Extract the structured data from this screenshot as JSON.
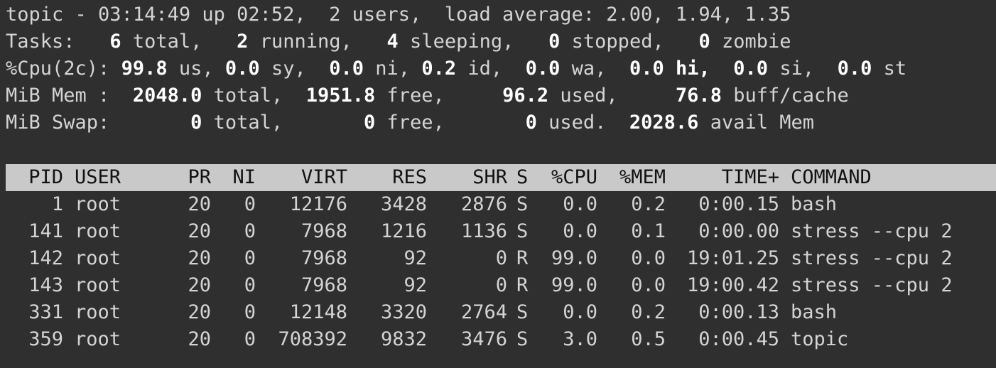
{
  "summary": {
    "uptime": {
      "label": "topic - ",
      "time": "03:14:49",
      "rest": " up 02:52,  2 users,  load average: 2.00, 1.94, 1.35"
    },
    "tasks": {
      "label": "Tasks:",
      "total": "6",
      "total_l": " total,",
      "running": "2",
      "running_l": " running,",
      "sleeping": "4",
      "sleeping_l": " sleeping,",
      "stopped": "0",
      "stopped_l": " stopped,",
      "zombie": "0",
      "zombie_l": " zombie"
    },
    "cpu": {
      "label": "%Cpu(2c):",
      "us": "99.8",
      "us_l": " us,",
      "sy": "0.0",
      "sy_l": " sy,",
      "ni": "0.0",
      "ni_l": " ni,",
      "id": "0.2",
      "id_l": " id,",
      "wa": "0.0",
      "wa_l": " wa,",
      "hi": "0.0",
      "hi_l": " hi,",
      "si": "0.0",
      "si_l": " si,",
      "st": "0.0",
      "st_l": " st"
    },
    "mem": {
      "label": "MiB Mem :",
      "total": "2048.0",
      "total_l": " total,",
      "free": "1951.8",
      "free_l": " free,",
      "used": "96.2",
      "used_l": " used,",
      "buff": "76.8",
      "buff_l": " buff/cache"
    },
    "swap": {
      "label": "MiB Swap:",
      "total": "0",
      "total_l": " total,",
      "free": "0",
      "free_l": " free,",
      "used": "0",
      "used_l": " used.",
      "avail": "2028.6",
      "avail_l": " avail Mem"
    }
  },
  "table": {
    "headers": {
      "pid": "PID",
      "user": "USER",
      "pr": "PR",
      "ni": "NI",
      "virt": "VIRT",
      "res": "RES",
      "shr": "SHR",
      "s": "S",
      "cpu": "%CPU",
      "mem": "%MEM",
      "time": "TIME+",
      "command": "COMMAND"
    },
    "rows": [
      {
        "pid": "1",
        "user": "root",
        "pr": "20",
        "ni": "0",
        "virt": "12176",
        "res": "3428",
        "shr": "2876",
        "s": "S",
        "cpu": "0.0",
        "mem": "0.2",
        "time": "0:00.15",
        "command": "bash"
      },
      {
        "pid": "141",
        "user": "root",
        "pr": "20",
        "ni": "0",
        "virt": "7968",
        "res": "1216",
        "shr": "1136",
        "s": "S",
        "cpu": "0.0",
        "mem": "0.1",
        "time": "0:00.00",
        "command": "stress --cpu 2"
      },
      {
        "pid": "142",
        "user": "root",
        "pr": "20",
        "ni": "0",
        "virt": "7968",
        "res": "92",
        "shr": "0",
        "s": "R",
        "cpu": "99.0",
        "mem": "0.0",
        "time": "19:01.25",
        "command": "stress --cpu 2"
      },
      {
        "pid": "143",
        "user": "root",
        "pr": "20",
        "ni": "0",
        "virt": "7968",
        "res": "92",
        "shr": "0",
        "s": "R",
        "cpu": "99.0",
        "mem": "0.0",
        "time": "19:00.42",
        "command": "stress --cpu 2"
      },
      {
        "pid": "331",
        "user": "root",
        "pr": "20",
        "ni": "0",
        "virt": "12148",
        "res": "3320",
        "shr": "2764",
        "s": "S",
        "cpu": "0.0",
        "mem": "0.2",
        "time": "0:00.13",
        "command": "bash"
      },
      {
        "pid": "359",
        "user": "root",
        "pr": "20",
        "ni": "0",
        "virt": "708392",
        "res": "9832",
        "shr": "3476",
        "s": "S",
        "cpu": "3.0",
        "mem": "0.5",
        "time": "0:00.45",
        "command": "topic"
      }
    ]
  }
}
